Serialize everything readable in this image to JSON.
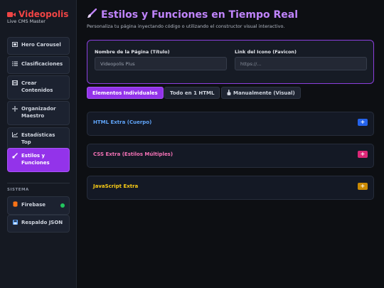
{
  "brand": {
    "title": "Videopolis",
    "subtitle": "Live CMS Master"
  },
  "sidebar": {
    "items": [
      {
        "label": "Hero Carousel",
        "icon": "image-icon"
      },
      {
        "label": "Clasificaciones",
        "icon": "list-icon"
      },
      {
        "label": "Crear Contenidos",
        "icon": "film-icon"
      },
      {
        "label": "Organizador Maestro",
        "icon": "move-icon"
      },
      {
        "label": "Estadísticas Top",
        "icon": "chart-icon"
      },
      {
        "label": "Estilos y Funciones",
        "icon": "brush-icon",
        "active": true
      }
    ],
    "system_label": "SISTEMA",
    "system_items": [
      {
        "label": "Firebase",
        "icon": "database-icon",
        "status": "ok"
      },
      {
        "label": "Respaldo JSON",
        "icon": "save-icon"
      }
    ]
  },
  "header": {
    "title": "Estilos y Funciones en Tiempo Real",
    "subtitle": "Personaliza tu página inyectando código o utilizando el constructor visual interactivo."
  },
  "settings": {
    "name_label": "Nombre de la Página (Título)",
    "name_value": "Videopolis Plus",
    "icon_label": "Link del Icono (Favicon)",
    "icon_placeholder": "https://..."
  },
  "tabs": [
    {
      "label": "Elementos Individuales",
      "active": true
    },
    {
      "label": "Todo en 1 HTML"
    },
    {
      "label": "Manualmente (Visual)",
      "icon": "hand-icon"
    }
  ],
  "sections": [
    {
      "title": "HTML Extra (Cuerpo)",
      "color": "#60a5fa",
      "button_color": "#2563eb",
      "button_label": "+"
    },
    {
      "title": "CSS Extra (Estilos Múltiples)",
      "color": "#f472b6",
      "button_color": "#db2777",
      "button_label": "+"
    },
    {
      "title": "JavaScript Extra",
      "color": "#facc15",
      "button_color": "#ca8a04",
      "button_label": "+"
    }
  ],
  "colors": {
    "accent": "#9333ea",
    "brand": "#ef4444",
    "ok": "#22c55e"
  }
}
